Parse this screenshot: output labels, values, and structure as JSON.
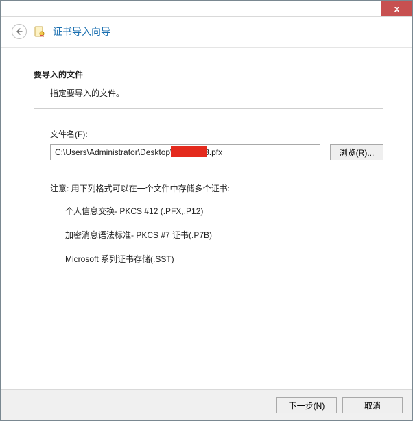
{
  "window": {
    "close_label": "x"
  },
  "header": {
    "title": "证书导入向导"
  },
  "content": {
    "section_title": "要导入的文件",
    "section_desc": "指定要导入的文件。",
    "file_label": "文件名(F):",
    "file_value": "C:\\Users\\Administrator\\Desktop\\          123.pfx",
    "browse_label": "浏览(R)...",
    "note": "注意: 用下列格式可以在一个文件中存储多个证书:",
    "formats": [
      "个人信息交换- PKCS #12 (.PFX,.P12)",
      "加密消息语法标准- PKCS #7 证书(.P7B)",
      "Microsoft 系列证书存储(.SST)"
    ]
  },
  "footer": {
    "next_label": "下一步(N)",
    "cancel_label": "取消"
  }
}
